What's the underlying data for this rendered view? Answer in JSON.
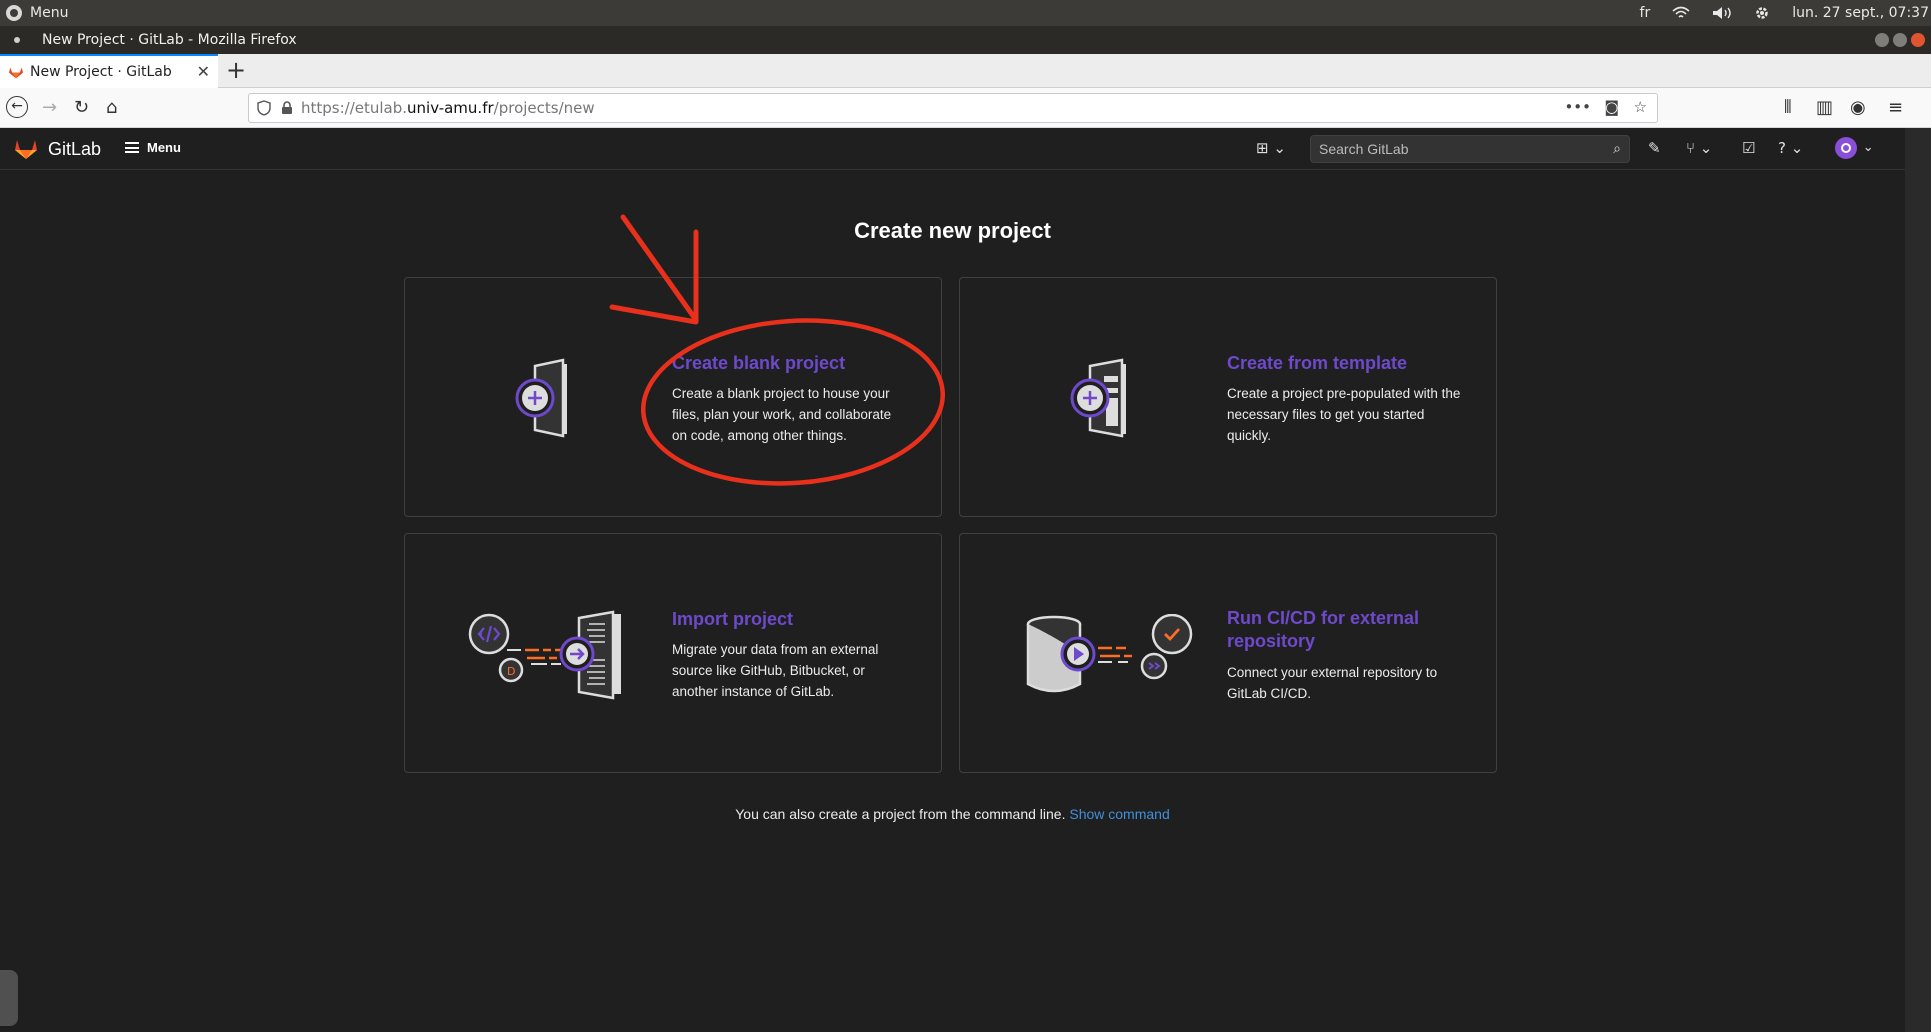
{
  "os": {
    "menu_label": "Menu",
    "keyboard_layout": "fr",
    "datetime": "lun. 27 sept., 07:37"
  },
  "browser": {
    "window_title": "New Project · GitLab - Mozilla Firefox",
    "tab_title": "New Project · GitLab",
    "url_prefix": "https://etulab.",
    "url_host": "univ-amu.fr",
    "url_path": "/projects/new"
  },
  "gitlab_header": {
    "brand": "GitLab",
    "menu_label": "Menu",
    "search_placeholder": "Search GitLab"
  },
  "main": {
    "title": "Create new project",
    "cards": [
      {
        "title": "Create blank project",
        "description": "Create a blank project to house your files, plan your work, and collaborate on code, among other things."
      },
      {
        "title": "Create from template",
        "description": "Create a project pre-populated with the necessary files to get you started quickly."
      },
      {
        "title": "Import project",
        "description": "Migrate your data from an external source like GitHub, Bitbucket, or another instance of GitLab."
      },
      {
        "title": "Run CI/CD for external repository",
        "description": "Connect your external repository to GitLab CI/CD."
      }
    ],
    "cmd_text": "You can also create a project from the command line.",
    "cmd_link": "Show command"
  },
  "colors": {
    "accent_purple": "#6e49cb",
    "link_blue": "#428fdc",
    "annotation_red": "#e8301c",
    "background": "#1f1f1f"
  }
}
